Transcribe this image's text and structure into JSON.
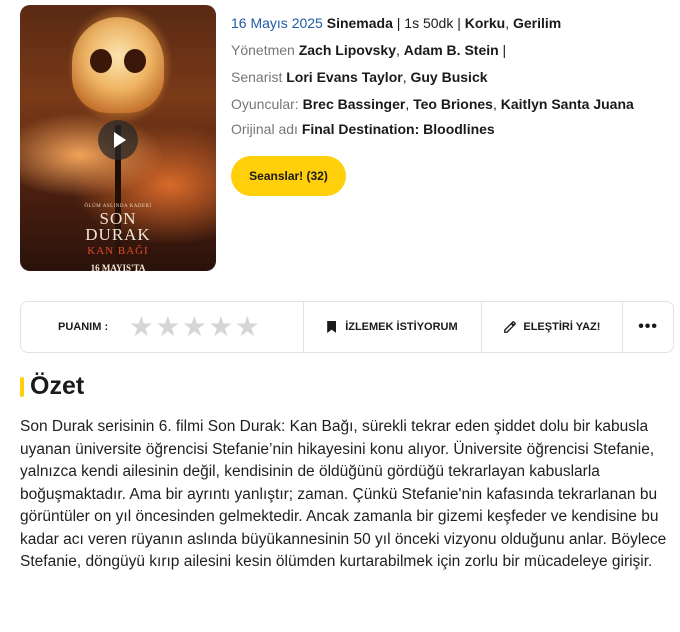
{
  "poster": {
    "tagline": "ÖLÜM ASLINDA KADERİ",
    "title_line1": "SON",
    "title_line2": "DURAK",
    "subtitle": "KAN BAĞI",
    "release": "16 MAYIS'TA",
    "play_icon": "play-icon"
  },
  "info": {
    "date": "16 Mayıs 2025",
    "status": "Sinemada",
    "sep1": " | ",
    "duration": "1s 50dk",
    "sep2": " | ",
    "genre1": "Korku",
    "comma1": ", ",
    "genre2": "Gerilim",
    "director_label": "Yönetmen ",
    "director1": "Zach Lipovsky",
    "comma2": ", ",
    "director2": "Adam B. Stein",
    "sep3": " |",
    "writer_label": "Senarist ",
    "writer1": "Lori Evans Taylor",
    "comma3": ", ",
    "writer2": "Guy Busick",
    "cast_label": "Oyuncular: ",
    "cast1": "Brec Bassinger",
    "comma4": ", ",
    "cast2": "Teo Briones",
    "comma5": ", ",
    "cast3": "Kaitlyn Santa Juana",
    "original_label": "Orijinal adı ",
    "original_title": "Final Destination: Bloodlines"
  },
  "seans_button": "Seanslar! (32)",
  "actions": {
    "rating_label": "PUANIM :",
    "stars": [
      "★",
      "★",
      "★",
      "★",
      "★"
    ],
    "rating_value": 0,
    "watchlist_label": "İZLEMEK İSTİYORUM",
    "review_label": "ELEŞTİRİ YAZ!",
    "more_label": "•••"
  },
  "summary": {
    "heading": "Özet",
    "text": "Son Durak serisinin 6. filmi Son Durak: Kan Bağı, sürekli tekrar eden şiddet dolu bir kabusla uyanan üniversite öğrencisi Stefanie’nin hikayesini konu alıyor. Üniversite öğrencisi Stefanie, yalnızca kendi ailesinin değil, kendisinin de öldüğünü gördüğü tekrarlayan kabuslarla boğuşmaktadır. Ama bir ayrıntı yanlıştır; zaman. Çünkü Stefanie'nin kafasında tekrarlanan bu görüntüler on yıl öncesinden gelmektedir. Ancak zamanla bir gizemi keşfeder ve kendisine bu kadar acı veren rüyanın aslında büyükannesinin 50 yıl önceki vizyonu olduğunu anlar. Böylece Stefanie, döngüyü kırıp ailesini kesin ölümden kurtarabilmek için zorlu bir mücadeleye girişir."
  },
  "colors": {
    "accent": "#ffcf0a",
    "date_blue": "#1f5aa6",
    "star_empty": "#d6d6d6"
  }
}
